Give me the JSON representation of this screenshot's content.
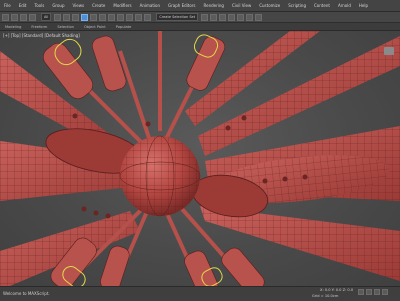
{
  "menu": {
    "items": [
      "File",
      "Edit",
      "Tools",
      "Group",
      "Views",
      "Create",
      "Modifiers",
      "Animation",
      "Graph Editors",
      "Rendering",
      "Civil View",
      "Customize",
      "Scripting",
      "Content",
      "Arnold",
      "Help"
    ]
  },
  "toolbar": {
    "selection_filter": "All",
    "selection_set": "Create Selection Set",
    "active_tool_icon": "select-move-icon"
  },
  "ribbon": {
    "tabs": [
      "Modeling",
      "Freeform",
      "Selection",
      "Object Paint",
      "Populate"
    ]
  },
  "viewport": {
    "label": "[+] [Top] [Standard] [Default Shading]",
    "model_color": "#c0534f",
    "highlight_color": "#e3d84a"
  },
  "status": {
    "left_text": "Welcome to MAXScript.",
    "coords": "X: 0.0  Y: 0.0  Z: 0.0",
    "grid": "Grid = 10.0cm",
    "add_time_tag": "Add Time Tag"
  }
}
